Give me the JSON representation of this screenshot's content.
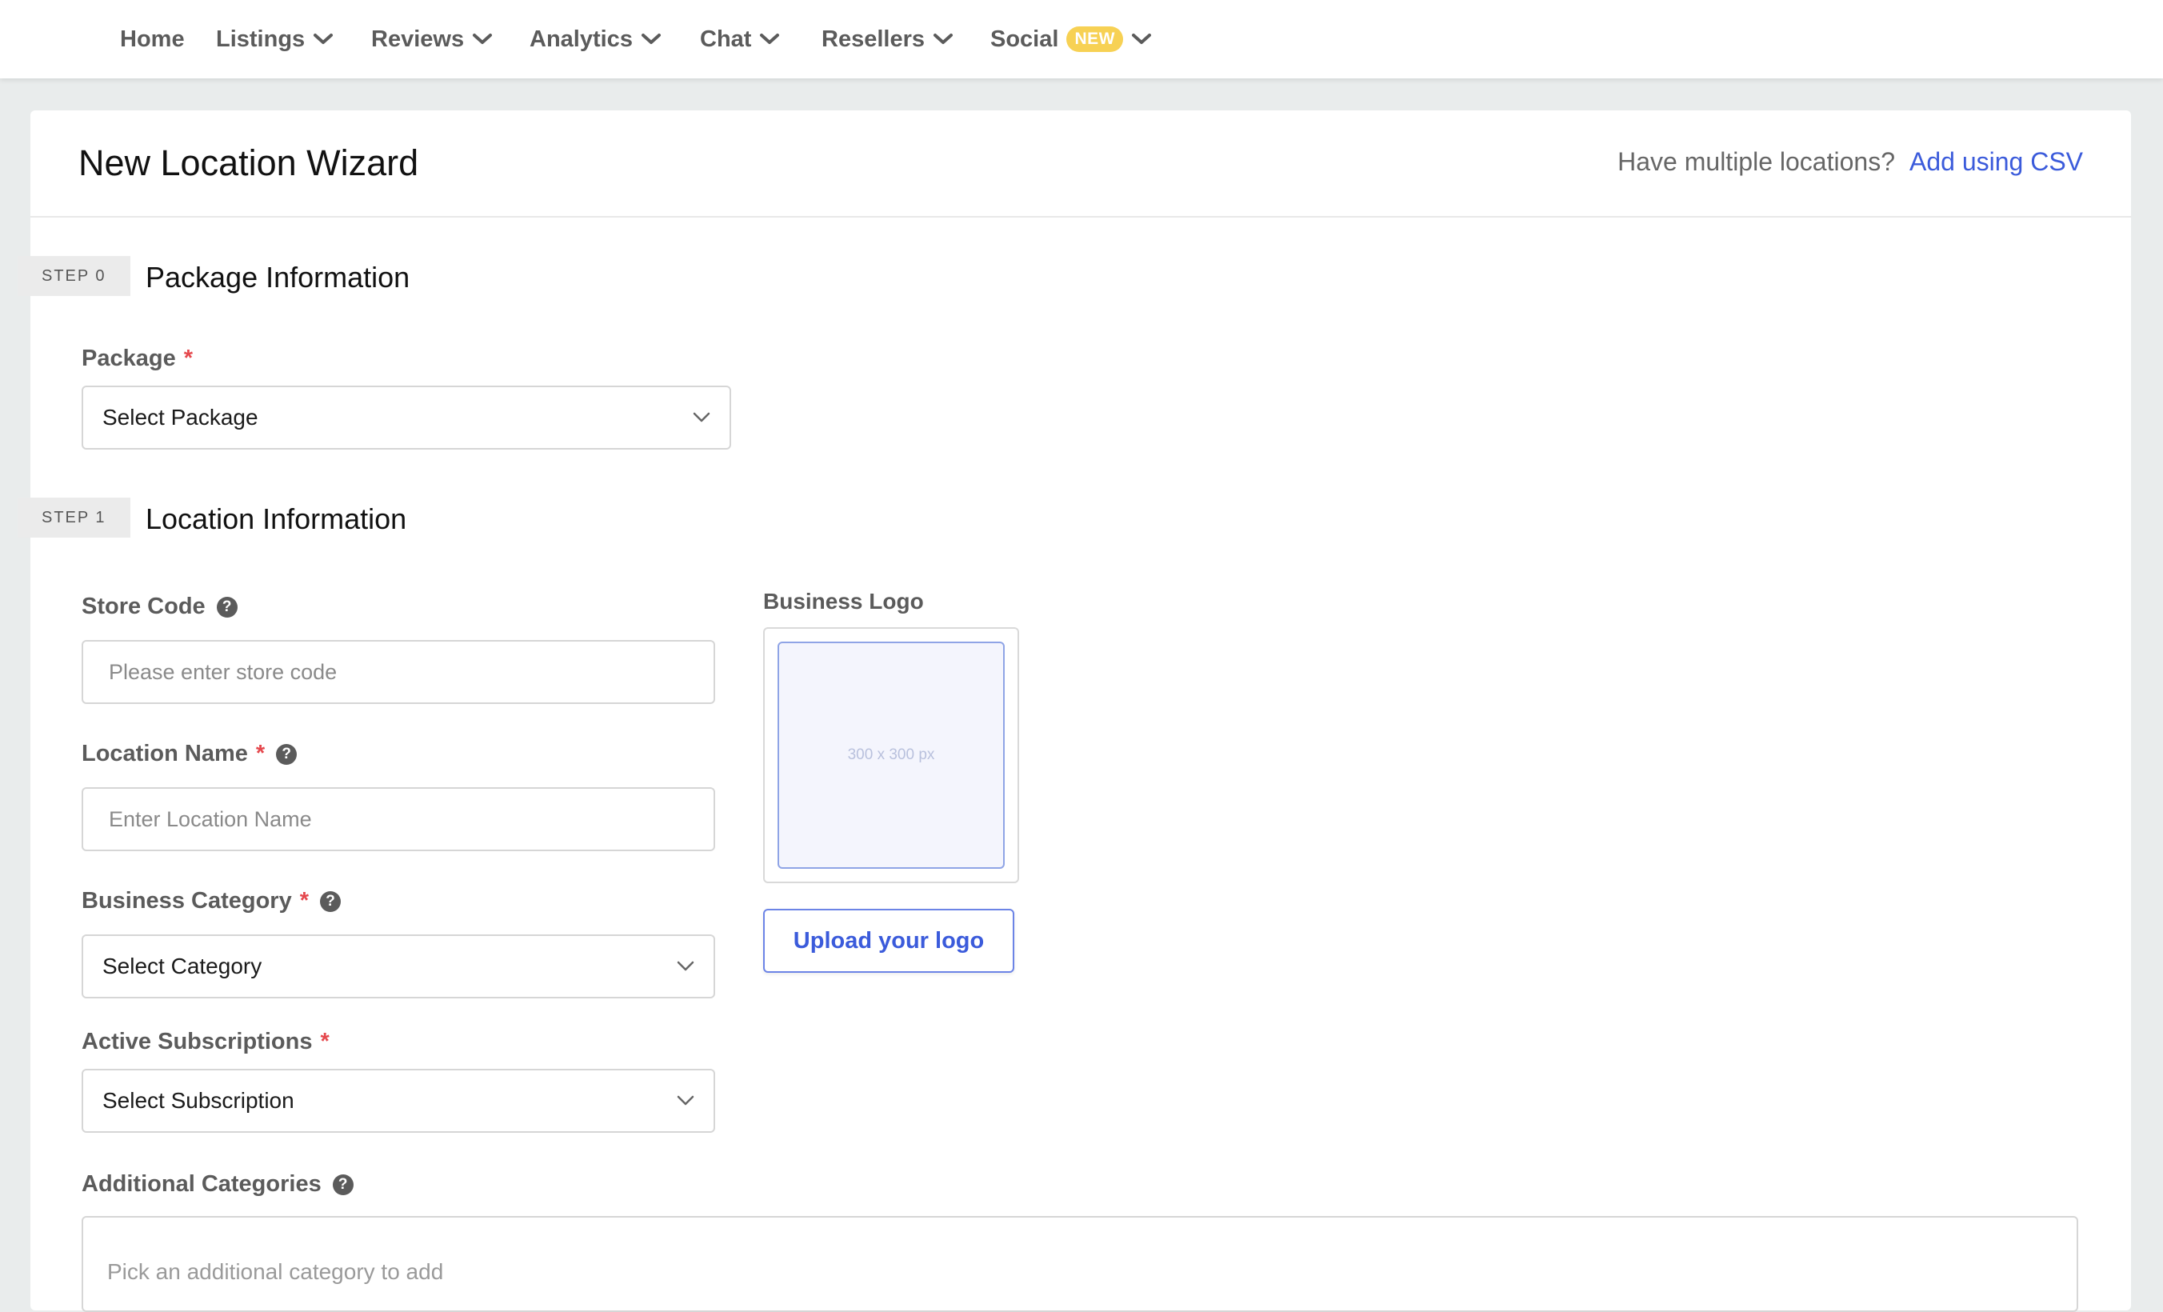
{
  "nav": {
    "items": [
      {
        "label": "Home",
        "has_dropdown": false
      },
      {
        "label": "Listings",
        "has_dropdown": true
      },
      {
        "label": "Reviews",
        "has_dropdown": true
      },
      {
        "label": "Analytics",
        "has_dropdown": true
      },
      {
        "label": "Chat",
        "has_dropdown": true
      },
      {
        "label": "Resellers",
        "has_dropdown": true
      },
      {
        "label": "Social",
        "has_dropdown": true,
        "badge": "NEW"
      }
    ]
  },
  "header": {
    "title": "New Location Wizard",
    "csv_prompt": "Have multiple locations?",
    "csv_link": "Add using CSV"
  },
  "step0": {
    "badge": "STEP 0",
    "title": "Package Information",
    "package": {
      "label": "Package",
      "required": "*",
      "value": "Select Package"
    }
  },
  "step1": {
    "badge": "STEP 1",
    "title": "Location Information",
    "store_code": {
      "label": "Store Code",
      "placeholder": "Please enter store code"
    },
    "location_name": {
      "label": "Location Name",
      "required": "*",
      "placeholder": "Enter Location Name"
    },
    "business_category": {
      "label": "Business Category",
      "required": "*",
      "value": "Select Category"
    },
    "active_subscriptions": {
      "label": "Active Subscriptions",
      "required": "*",
      "value": "Select Subscription"
    },
    "additional_categories": {
      "label": "Additional Categories",
      "placeholder": "Pick an additional category to add"
    },
    "business_logo": {
      "label": "Business Logo",
      "size_hint": "300 x 300 px",
      "upload_label": "Upload your logo"
    }
  },
  "colors": {
    "accent": "#3b5bdb",
    "required": "#e5484d",
    "badge_new": "#f7d154",
    "page_bg": "#e9ecec"
  },
  "icons": {
    "dropdown": "chevron-down-icon",
    "help": "question-circle-icon"
  }
}
